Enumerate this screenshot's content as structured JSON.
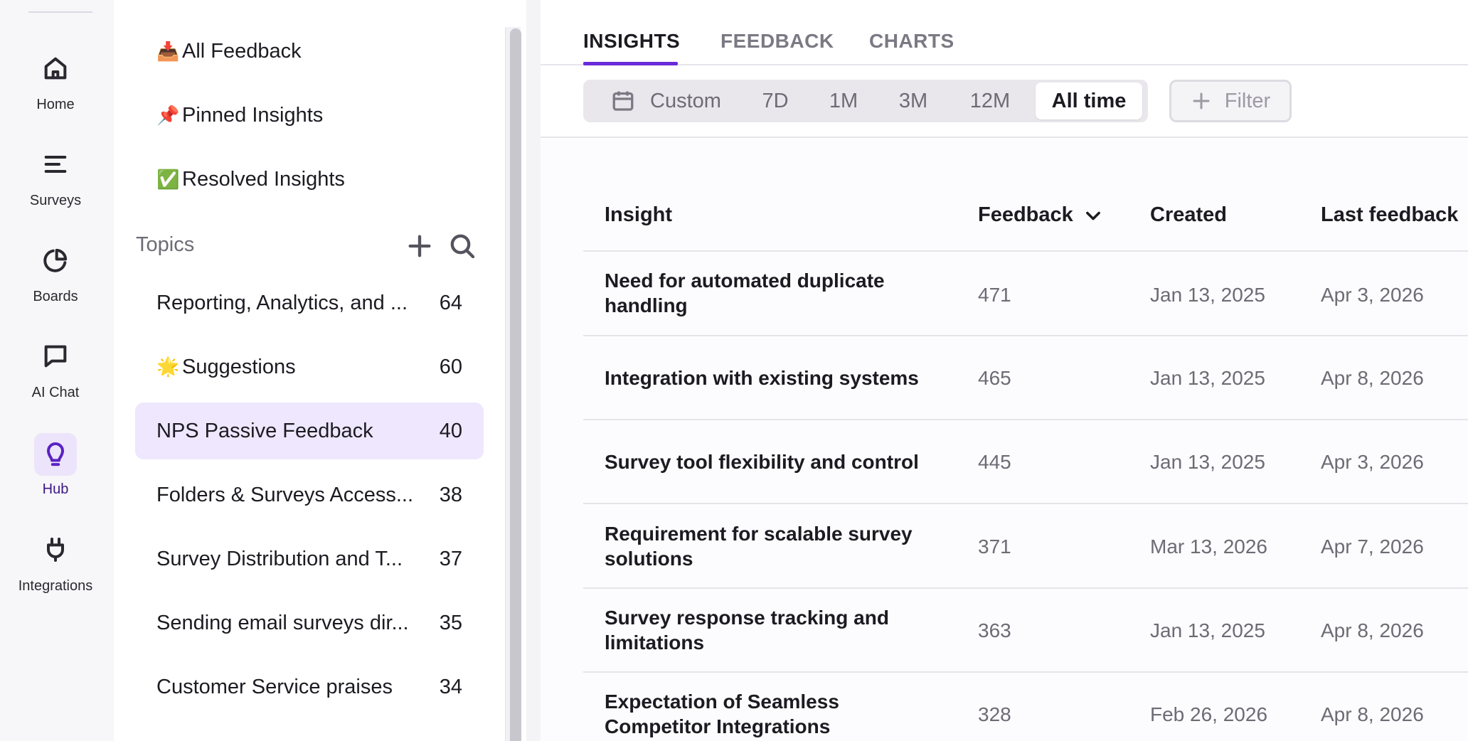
{
  "rail": {
    "items": [
      {
        "label": "Home",
        "icon": "home-icon"
      },
      {
        "label": "Surveys",
        "icon": "list-icon"
      },
      {
        "label": "Boards",
        "icon": "pie-chart-icon"
      },
      {
        "label": "AI Chat",
        "icon": "chat-icon"
      },
      {
        "label": "Hub",
        "icon": "lightbulb-icon",
        "active": true
      },
      {
        "label": "Integrations",
        "icon": "plug-icon"
      }
    ]
  },
  "panel": {
    "nav": [
      {
        "emoji": "📥",
        "label": "All Feedback"
      },
      {
        "emoji": "📌",
        "label": "Pinned Insights"
      },
      {
        "emoji": "✅",
        "label": "Resolved Insights"
      }
    ],
    "topics_title": "Topics",
    "topics": [
      {
        "emoji": "",
        "label": "Reporting, Analytics, and ...",
        "count": "64"
      },
      {
        "emoji": "🌟",
        "label": "Suggestions",
        "count": "60"
      },
      {
        "emoji": "",
        "label": "NPS Passive Feedback",
        "count": "40",
        "selected": true
      },
      {
        "emoji": "",
        "label": "Folders & Surveys Access...",
        "count": "38"
      },
      {
        "emoji": "",
        "label": "Survey Distribution and T...",
        "count": "37"
      },
      {
        "emoji": "",
        "label": "Sending email surveys dir...",
        "count": "35"
      },
      {
        "emoji": "",
        "label": "Customer Service praises",
        "count": "34"
      }
    ]
  },
  "tabs": [
    "INSIGHTS",
    "FEEDBACK",
    "CHARTS"
  ],
  "range": {
    "options": [
      "Custom",
      "7D",
      "1M",
      "3M",
      "12M",
      "All time"
    ],
    "selected": "All time"
  },
  "filter_label": "Filter",
  "table": {
    "headers": [
      "Insight",
      "Feedback",
      "Created",
      "Last feedback"
    ],
    "rows": [
      {
        "insight_1": "Need for automated duplicate",
        "insight_2": "handling",
        "feedback": "471",
        "created": "Jan 13, 2025",
        "last": "Apr 3, 2026"
      },
      {
        "insight_1": "Integration with existing systems",
        "insight_2": "",
        "feedback": "465",
        "created": "Jan 13, 2025",
        "last": "Apr 8, 2026"
      },
      {
        "insight_1": "Survey tool flexibility and control",
        "insight_2": "",
        "feedback": "445",
        "created": "Jan 13, 2025",
        "last": "Apr 3, 2026"
      },
      {
        "insight_1": "Requirement for scalable survey",
        "insight_2": "solutions",
        "feedback": "371",
        "created": "Mar 13, 2026",
        "last": "Apr 7, 2026"
      },
      {
        "insight_1": "Survey response tracking and",
        "insight_2": "limitations",
        "feedback": "363",
        "created": "Jan 13, 2025",
        "last": "Apr 8, 2026"
      },
      {
        "insight_1": "Expectation of Seamless",
        "insight_2": "Competitor Integrations",
        "feedback": "328",
        "created": "Feb 26, 2026",
        "last": "Apr 8, 2026"
      }
    ]
  },
  "colors": {
    "accent": "#6a2bd9",
    "selected_bg": "#efe7fd"
  }
}
